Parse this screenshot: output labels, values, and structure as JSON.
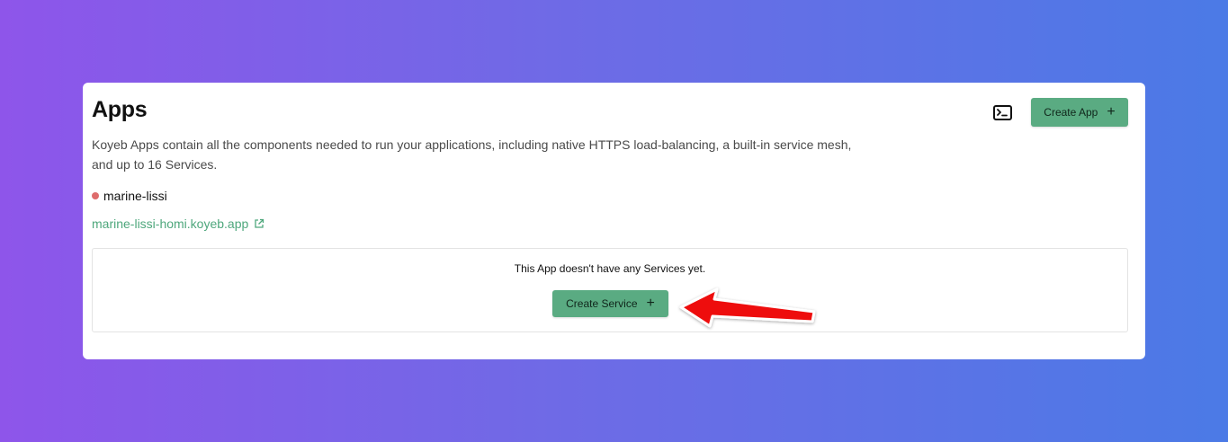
{
  "header": {
    "title": "Apps",
    "description": "Koyeb Apps contain all the components needed to run your applications, including native HTTPS load-balancing, a built-in service mesh, and up to 16 Services.",
    "terminal_icon": "terminal-icon",
    "create_app_label": "Create App"
  },
  "app": {
    "name": "marine-lissi",
    "status_color": "#de6c6c",
    "url": "marine-lissi-homi.koyeb.app",
    "url_icon": "external-link-icon"
  },
  "services": {
    "empty_message": "This App doesn't have any Services yet.",
    "create_service_label": "Create Service"
  },
  "annotation": {
    "arrow_color": "#ee1111"
  },
  "colors": {
    "accent": "#5aab82",
    "link": "#4ea77c"
  }
}
